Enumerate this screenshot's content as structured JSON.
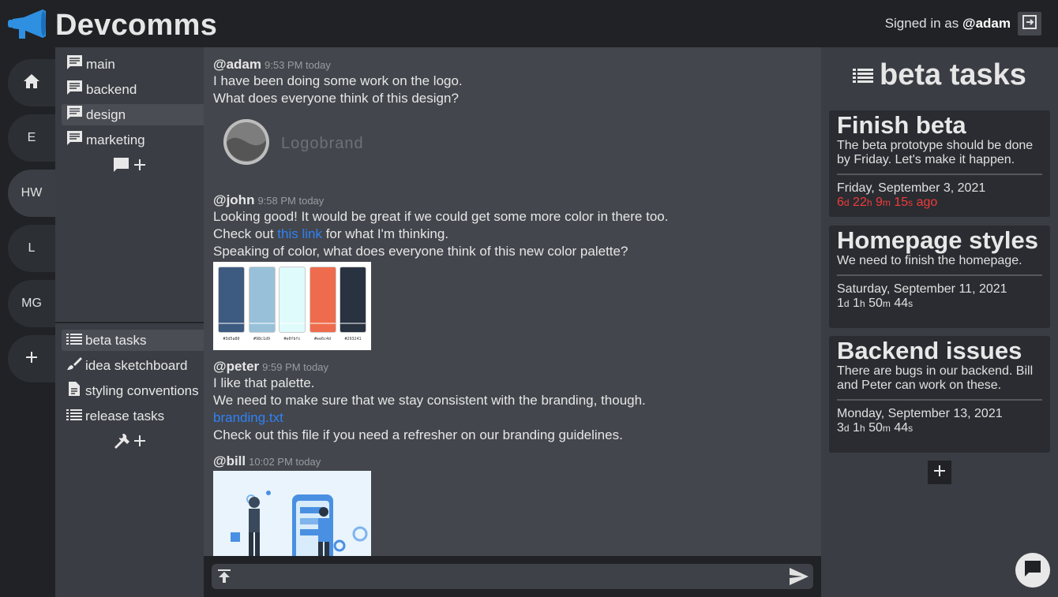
{
  "app": {
    "title": "Devcomms",
    "signed_prefix": "Signed in as",
    "user": "@adam"
  },
  "servers": [
    "E",
    "HW",
    "L",
    "MG"
  ],
  "channels": [
    "main",
    "backend",
    "design",
    "marketing"
  ],
  "tools": [
    "beta tasks",
    "idea sketchboard",
    "styling conventions",
    "release tasks"
  ],
  "messages": {
    "m1": {
      "user": "@adam",
      "time": "9:53 PM today",
      "lines": [
        "I have been doing some work on the logo.",
        "What does everyone think of this design?"
      ],
      "logo_text": "Logobrand"
    },
    "m2": {
      "user": "@john",
      "time": "9:58 PM today",
      "line1": "Looking good! It would be great if we could get some more color in there too.",
      "line2_pre": "Check out",
      "line2_link": "this link",
      "line2_post": "for what I'm thinking.",
      "line3": "Speaking of color, what does everyone think of this new color palette?",
      "palette": [
        {
          "hex": "#3d5a80",
          "label": "#3d5a80"
        },
        {
          "hex": "#98c1d9",
          "label": "#98c1d9"
        },
        {
          "hex": "#e0fbfc",
          "label": "#e0fbfc"
        },
        {
          "hex": "#ee6c4d",
          "label": "#ee6c4d"
        },
        {
          "hex": "#293241",
          "label": "#293241"
        }
      ]
    },
    "m3": {
      "user": "@peter",
      "time": "9:59 PM today",
      "line1": "I like that palette.",
      "line2": "We need to make sure that we stay consistent with the branding, though.",
      "file": "branding.txt",
      "line3": "Check out this file if you need a refresher on our branding guidelines."
    },
    "m4": {
      "user": "@bill",
      "time": "10:02 PM today"
    }
  },
  "tasks": {
    "title": "beta tasks",
    "items": [
      {
        "title": "Finish beta",
        "desc": "The beta prototype should be done by Friday. Let's make it happen.",
        "date": "Friday, September 3, 2021",
        "cd": {
          "d": "6",
          "h": "22",
          "m": "9",
          "s": "15",
          "suffix": "ago"
        }
      },
      {
        "title": "Homepage styles",
        "desc": "We need to finish the homepage.",
        "date": "Saturday, September 11, 2021",
        "cd": {
          "d": "1",
          "h": "1",
          "m": "50",
          "s": "44"
        }
      },
      {
        "title": "Backend issues",
        "desc": "There are bugs in our backend. Bill and Peter can work on these.",
        "date": "Monday, September 13, 2021",
        "cd": {
          "d": "3",
          "h": "1",
          "m": "50",
          "s": "44"
        }
      }
    ]
  },
  "units": {
    "d": "d",
    "h": "h",
    "m": "m",
    "s": "s"
  },
  "colors": {
    "bg": "#202226",
    "panel": "#3a3d43",
    "chat": "#43464c",
    "link": "#2f81f7",
    "overdue": "#ef3b3b",
    "brand_blue": "#2f8fe0"
  }
}
